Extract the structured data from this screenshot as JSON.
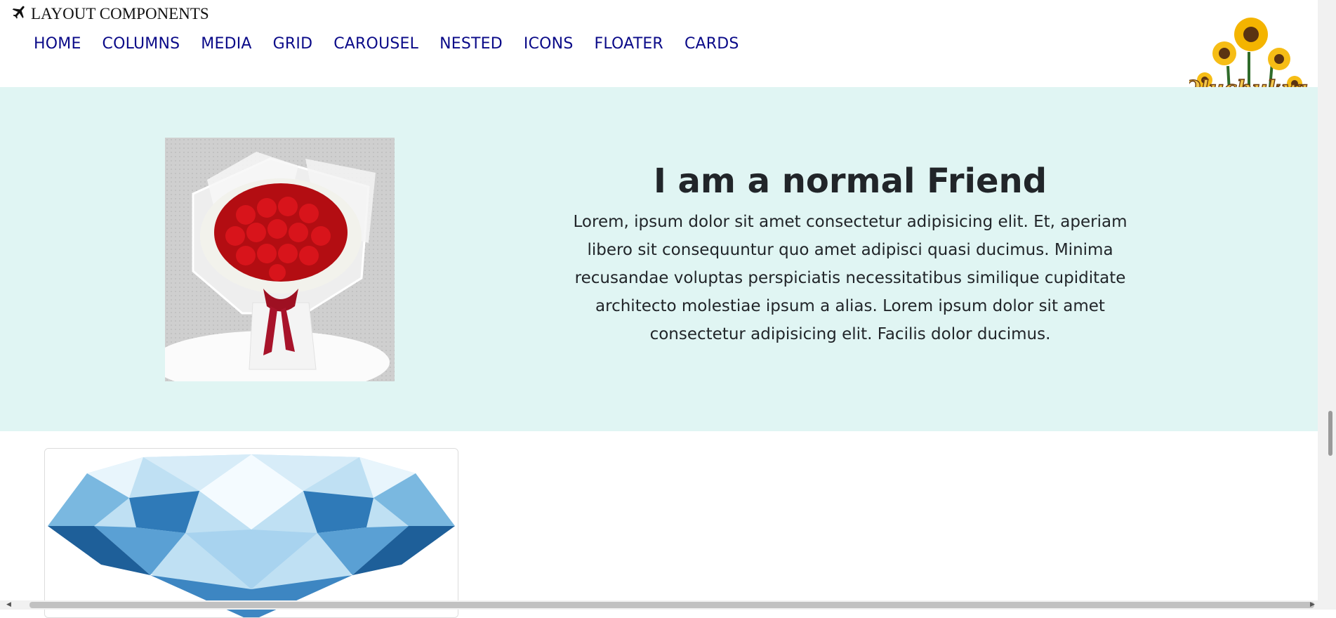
{
  "brand": {
    "icon": "airplane-icon",
    "text": "LAYOUT COMPONENTS"
  },
  "nav": {
    "items": [
      "HOME",
      "COLUMNS",
      "MEDIA",
      "GRID",
      "CAROUSEL",
      "NESTED",
      "ICONS",
      "FLOATER",
      "CARDS"
    ],
    "color": "#0a0a88"
  },
  "logo": {
    "text": "Oluchukwu",
    "icon": "sunflower-logo-icon"
  },
  "hero": {
    "background": "#e0f5f3",
    "image": "red-rose-bouquet-image",
    "title": "I am a normal Friend",
    "body": "Lorem, ipsum dolor sit amet consectetur adipisicing elit. Et, aperiam libero sit consequuntur quo amet adipisci quasi ducimus. Minima recusandae voluptas perspiciatis necessitatibus similique cupiditate architecto molestiae ipsum a alias. Lorem ipsum dolor sit amet consectetur adipisicing elit. Facilis dolor ducimus."
  },
  "card": {
    "image": "diamond-image"
  }
}
